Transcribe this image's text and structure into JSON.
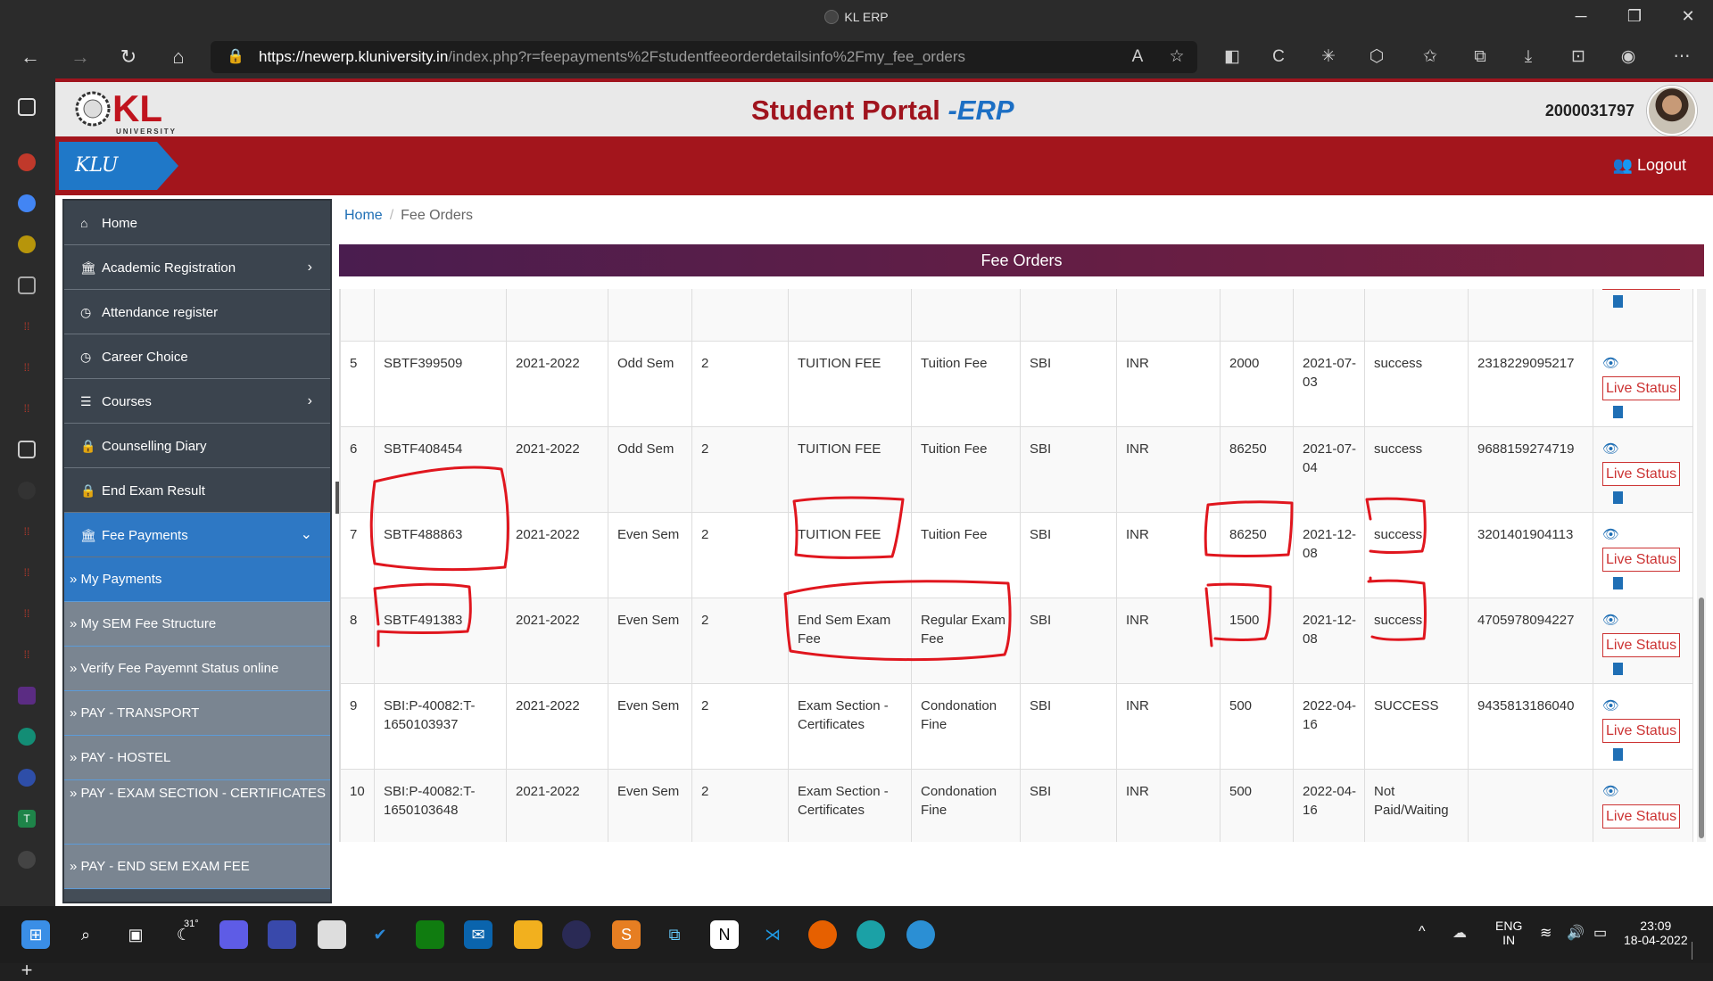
{
  "window": {
    "title": "KL ERP"
  },
  "browser": {
    "url_host": "https://newerp.kluniversity.in",
    "url_path": "/index.php?r=feepayments%2Fstudentfeeorderdetailsinfo%2Fmy_fee_orders"
  },
  "header": {
    "portal_title": "Student Portal ",
    "portal_suffix": "-ERP",
    "user_id": "2000031797",
    "logo_text": "KL",
    "logo_sub": "UNIVERSITY"
  },
  "redbar": {
    "badge": "KLU ERP",
    "logout": "Logout"
  },
  "menu": {
    "items": [
      {
        "label": "Home",
        "icon": "home-icon"
      },
      {
        "label": "Academic Registration",
        "icon": "institution-icon"
      },
      {
        "label": "Attendance register",
        "icon": "clock-icon"
      },
      {
        "label": "Career Choice",
        "icon": "clock-icon"
      },
      {
        "label": "Courses",
        "icon": "list-icon"
      },
      {
        "label": "Counselling Diary",
        "icon": "lock-icon"
      },
      {
        "label": "End Exam Result",
        "icon": "lock-icon"
      },
      {
        "label": "Fee Payments",
        "icon": "institution-icon"
      }
    ],
    "subitems": [
      "» My Payments",
      "» My SEM Fee Structure",
      "» Verify Fee Payemnt Status online",
      "» PAY - TRANSPORT",
      "» PAY - HOSTEL",
      "» PAY - EXAM SECTION - CERTIFICATES",
      "» PAY - END SEM EXAM FEE"
    ]
  },
  "breadcrumb": {
    "home": "Home",
    "current": "Fee Orders"
  },
  "panel": {
    "title": "Fee Orders"
  },
  "rows": [
    {
      "sno": "",
      "order": "",
      "year": "",
      "sem": "",
      "yr": "",
      "ftype": "",
      "fname": "",
      "bank": "",
      "cur": "",
      "amt": "",
      "date": "",
      "status": "",
      "ref": ""
    },
    {
      "sno": "5",
      "order": "SBTF399509",
      "year": "2021-2022",
      "sem": "Odd Sem",
      "yr": "2",
      "ftype": "TUITION FEE",
      "fname": "Tuition Fee",
      "bank": "SBI",
      "cur": "INR",
      "amt": "2000",
      "date": "2021-07-03",
      "status": "success",
      "ref": "2318229095217"
    },
    {
      "sno": "6",
      "order": "SBTF408454",
      "year": "2021-2022",
      "sem": "Odd Sem",
      "yr": "2",
      "ftype": "TUITION FEE",
      "fname": "Tuition Fee",
      "bank": "SBI",
      "cur": "INR",
      "amt": "86250",
      "date": "2021-07-04",
      "status": "success",
      "ref": "9688159274719"
    },
    {
      "sno": "7",
      "order": "SBTF488863",
      "year": "2021-2022",
      "sem": "Even Sem",
      "yr": "2",
      "ftype": "TUITION FEE",
      "fname": "Tuition Fee",
      "bank": "SBI",
      "cur": "INR",
      "amt": "86250",
      "date": "2021-12-08",
      "status": "success",
      "ref": "3201401904113"
    },
    {
      "sno": "8",
      "order": "SBTF491383",
      "year": "2021-2022",
      "sem": "Even Sem",
      "yr": "2",
      "ftype": "End Sem Exam Fee",
      "fname": "Regular Exam Fee",
      "bank": "SBI",
      "cur": "INR",
      "amt": "1500",
      "date": "2021-12-08",
      "status": "success",
      "ref": "4705978094227"
    },
    {
      "sno": "9",
      "order": "SBI:P-40082:T-1650103937",
      "year": "2021-2022",
      "sem": "Even Sem",
      "yr": "2",
      "ftype": "Exam Section - Certificates",
      "fname": "Condonation Fine",
      "bank": "SBI",
      "cur": "INR",
      "amt": "500",
      "date": "2022-04-16",
      "status": "SUCCESS",
      "ref": "9435813186040"
    },
    {
      "sno": "10",
      "order": "SBI:P-40082:T-1650103648",
      "year": "2021-2022",
      "sem": "Even Sem",
      "yr": "2",
      "ftype": "Exam Section - Certificates",
      "fname": "Condonation Fine",
      "bank": "SBI",
      "cur": "INR",
      "amt": "500",
      "date": "2022-04-16",
      "status": "Not Paid/Waiting",
      "ref": ""
    }
  ],
  "live_status_label": "Live Status",
  "taskbar": {
    "weather": "31°",
    "lang1": "ENG",
    "lang2": "IN",
    "time": "23:09",
    "date": "18-04-2022"
  },
  "colors": {
    "brand_red": "#a3151c",
    "accent_blue": "#2e78c4",
    "annotation": "#e0161e"
  }
}
